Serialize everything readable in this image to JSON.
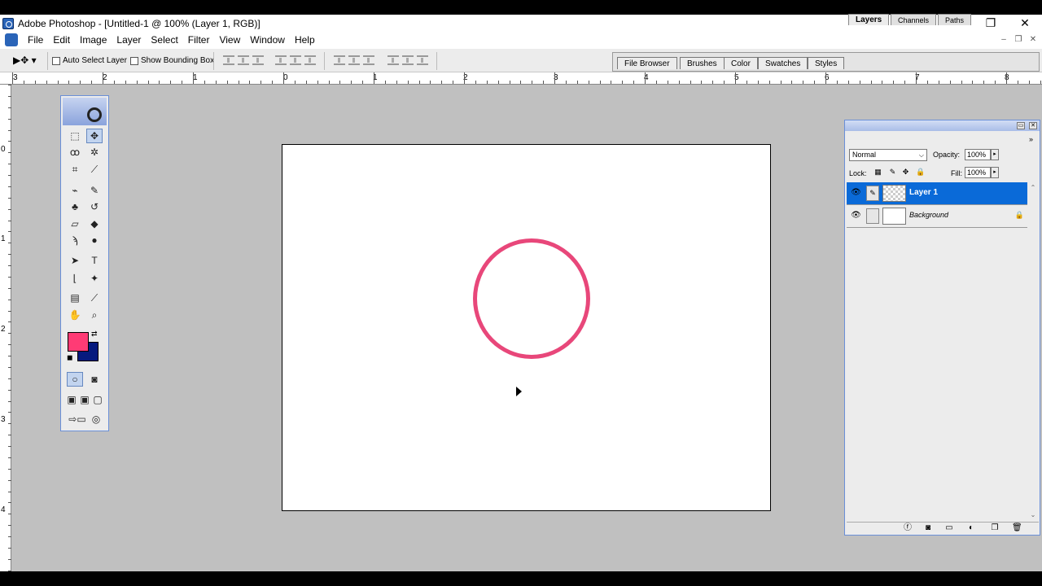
{
  "window": {
    "title": "Adobe Photoshop - [Untitled-1 @ 100% (Layer 1, RGB)]",
    "minimize_glyph": "─",
    "restore_glyph": "❐",
    "close_glyph": "✕"
  },
  "menu": [
    "File",
    "Edit",
    "Image",
    "Layer",
    "Select",
    "Filter",
    "View",
    "Window",
    "Help"
  ],
  "doc_controls": {
    "minimize": "–",
    "restore": "❐",
    "close": "✕"
  },
  "options": {
    "tool_glyph": "▶✥ ▾",
    "auto_select": "Auto Select Layer",
    "show_bounding": "Show Bounding Box"
  },
  "palette_well": [
    "File Browser",
    "Brushes",
    "Color",
    "Swatches",
    "Styles"
  ],
  "ruler_h": [
    "3",
    "2",
    "1",
    "0",
    "1",
    "2",
    "3",
    "4",
    "5",
    "6",
    "7",
    "8"
  ],
  "ruler_v": [
    "0",
    "1",
    "2",
    "3",
    "4"
  ],
  "colors": {
    "foreground": "#ff3b75",
    "background": "#061a7e",
    "stroke": "#e8477a",
    "layer_selected": "#0a6ad8"
  },
  "layers_panel": {
    "tabs": [
      "Layers",
      "Channels",
      "Paths"
    ],
    "blend_mode": "Normal",
    "opacity_label": "Opacity:",
    "opacity_value": "100%",
    "lock_label": "Lock:",
    "fill_label": "Fill:",
    "fill_value": "100%",
    "layers": [
      {
        "name": "Layer 1",
        "selected": true
      },
      {
        "name": "Background",
        "locked": true
      }
    ]
  },
  "icons": {
    "eye": "eye-icon",
    "brush": "brush-icon",
    "lock": "lock-icon",
    "move": "move-tool-icon",
    "marquee": "marquee-tool-icon",
    "type": "type-tool-icon",
    "zoom": "zoom-tool-icon",
    "hand": "hand-tool-icon"
  }
}
